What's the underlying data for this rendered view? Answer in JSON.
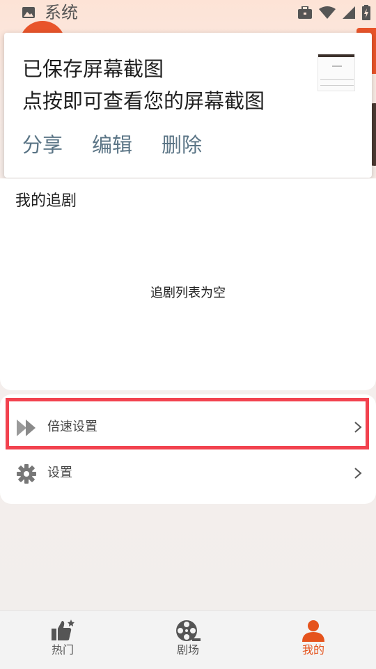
{
  "status_bar": {
    "title": "系统",
    "icons": [
      "image-icon",
      "briefcase-icon",
      "wifi-icon",
      "signal-icon",
      "battery-icon"
    ]
  },
  "screenshot_notification": {
    "title": "已保存屏幕截图",
    "subtitle": "点按即可查看您的屏幕截图",
    "actions": [
      "分享",
      "编辑",
      "删除"
    ]
  },
  "my_dramas": {
    "title": "我的追剧",
    "empty_text": "追剧列表为空"
  },
  "settings": {
    "items": [
      {
        "label": "倍速设置",
        "icon": "fast-forward-icon",
        "highlighted": true
      },
      {
        "label": "设置",
        "icon": "gear-icon",
        "highlighted": false
      }
    ]
  },
  "bottom_nav": {
    "items": [
      {
        "label": "热门",
        "icon": "thumbs-up-icon",
        "active": false
      },
      {
        "label": "剧场",
        "icon": "film-reel-icon",
        "active": false
      },
      {
        "label": "我的",
        "icon": "person-icon",
        "active": true
      }
    ]
  },
  "colors": {
    "accent": "#e5531c",
    "highlight_border": "#f2424f",
    "notification_action": "#5b7586"
  }
}
